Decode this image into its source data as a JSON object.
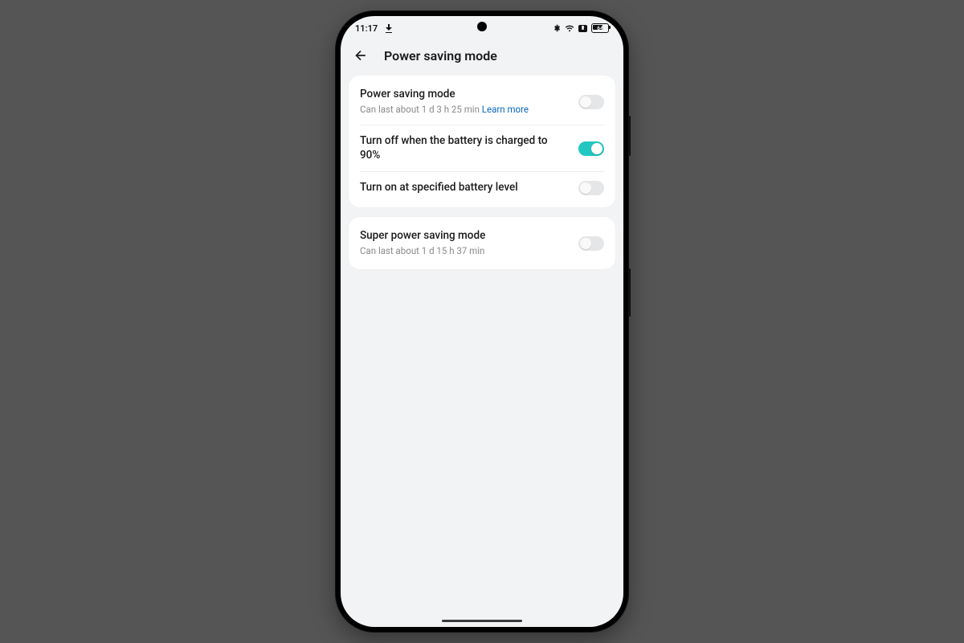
{
  "status": {
    "time": "11:17",
    "battery_pct": "64"
  },
  "header": {
    "title": "Power saving mode"
  },
  "card1": {
    "row1": {
      "label": "Power saving mode",
      "sub": "Can last about 1 d 3 h 25 min ",
      "link": "Learn more",
      "toggle": false
    },
    "row2": {
      "label": "Turn off when the battery is charged to 90%",
      "toggle": true
    },
    "row3": {
      "label": "Turn on at specified battery level",
      "toggle": false
    }
  },
  "card2": {
    "row1": {
      "label": "Super power saving mode",
      "sub": "Can last about 1 d 15 h 37 min",
      "toggle": false
    }
  }
}
